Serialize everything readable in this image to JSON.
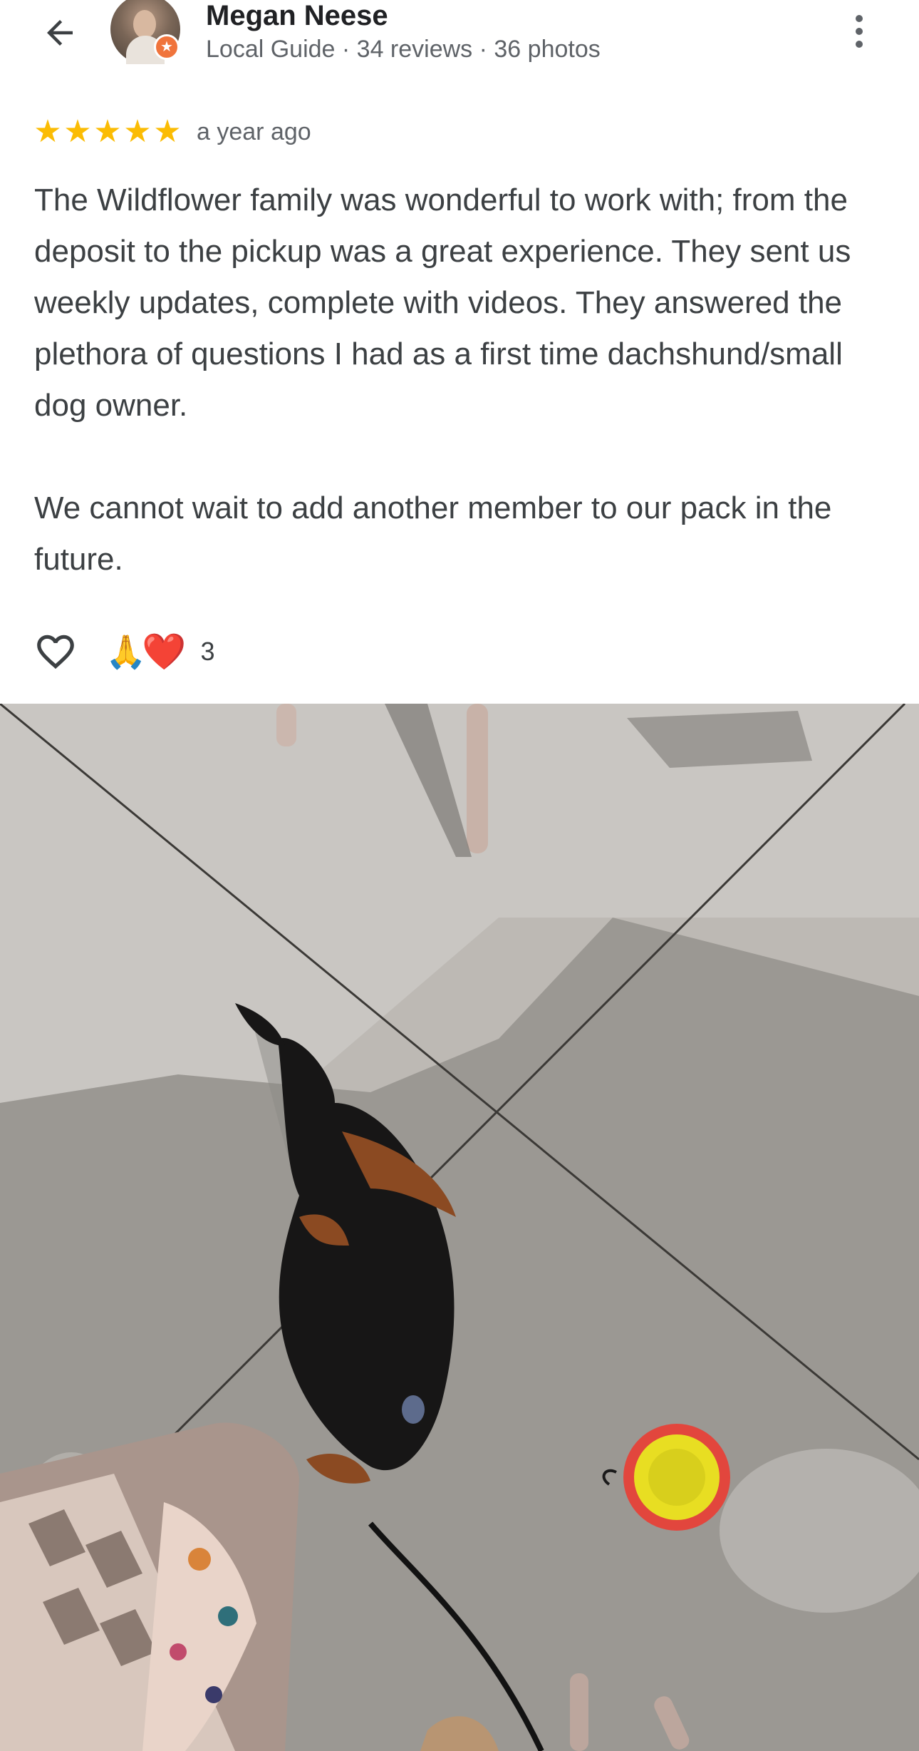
{
  "header": {
    "back_icon": "arrow-left-icon",
    "reviewer_name": "Megan Neese",
    "reviewer_meta": "Local Guide · 34 reviews · 36 photos",
    "badge_icon": "local-guide-star-icon",
    "more_icon": "more-vertical-icon"
  },
  "review": {
    "rating": 5,
    "rating_max": 5,
    "time": "a year ago",
    "paragraph_1": "The Wildflower family was wonderful to work with; from the deposit to the pickup was a great experience. They sent us weekly updates, complete with videos. They answered the plethora of questions I had as a first time dachshund/small dog owner.",
    "paragraph_2": "We cannot wait to add another member to our pack in the future."
  },
  "reactions": {
    "like_icon": "heart-outline-icon",
    "emojis": [
      "🙏",
      "❤️"
    ],
    "count": "3"
  },
  "colors": {
    "star": "#fbbc04",
    "badge": "#f0743c",
    "text": "#3c4043",
    "meta": "#5f6368"
  }
}
